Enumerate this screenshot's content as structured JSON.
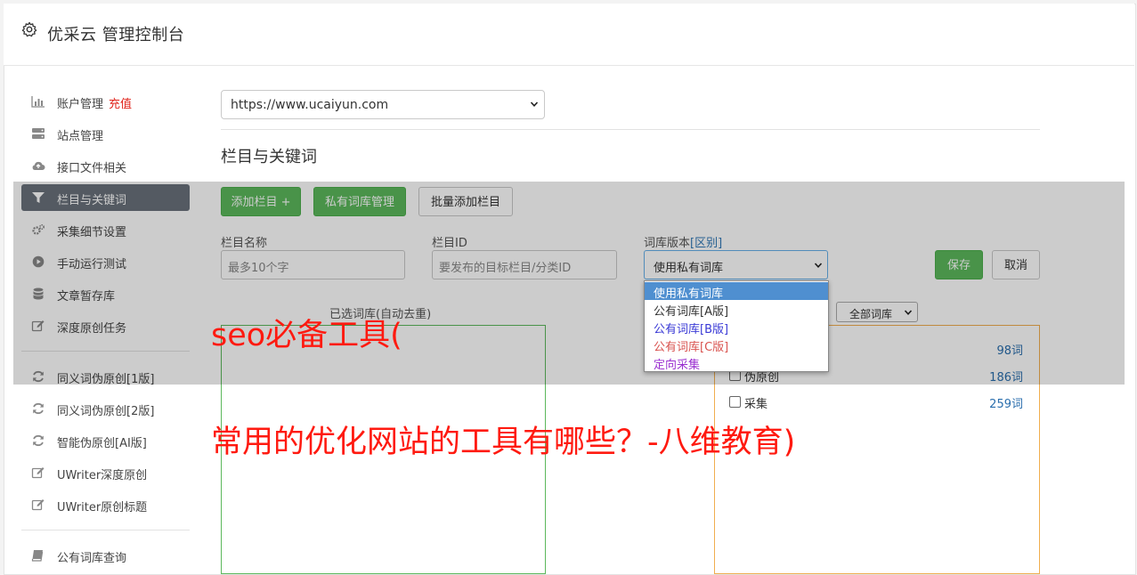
{
  "app": {
    "title": "优采云 管理控制台",
    "icon": "gear-icon"
  },
  "sidebar": {
    "items": [
      {
        "label": "账户管理",
        "badge": "充值",
        "icon": "bar-chart-icon"
      },
      {
        "label": "站点管理",
        "icon": "server-icon"
      },
      {
        "label": "接口文件相关",
        "icon": "cloud-upload-icon"
      },
      {
        "label": "栏目与关键词",
        "icon": "filter-icon",
        "active": true
      },
      {
        "label": "采集细节设置",
        "icon": "cogs-icon"
      },
      {
        "label": "手动运行测试",
        "icon": "play-circle-icon"
      },
      {
        "label": "文章暂存库",
        "icon": "database-icon"
      },
      {
        "label": "深度原创任务",
        "icon": "edit-icon"
      },
      {
        "label": "同义词伪原创[1版]",
        "icon": "refresh-icon"
      },
      {
        "label": "同义词伪原创[2版]",
        "icon": "refresh-icon"
      },
      {
        "label": "智能伪原创[AI版]",
        "icon": "refresh-icon"
      },
      {
        "label": "UWriter深度原创",
        "icon": "edit-icon"
      },
      {
        "label": "UWriter原创标题",
        "icon": "edit-icon"
      },
      {
        "label": "公有词库查询",
        "icon": "book-icon"
      }
    ]
  },
  "site_select": {
    "value": "https://www.ucaiyun.com"
  },
  "section_title": "栏目与关键词",
  "toolbar": {
    "add_column": "添加栏目 +",
    "private_lexicon": "私有词库管理",
    "batch_add": "批量添加栏目"
  },
  "form": {
    "column_name": {
      "label": "栏目名称",
      "placeholder": "最多10个字"
    },
    "column_id": {
      "label": "栏目ID",
      "placeholder": "要发布的目标栏目/分类ID"
    },
    "lexicon_version": {
      "label": "词库版本",
      "link": "[区别]",
      "value": "使用私有词库",
      "options": [
        {
          "label": "使用私有词库",
          "color": "#ffffff",
          "selected": true
        },
        {
          "label": "公有词库[A版]",
          "color": "#333333"
        },
        {
          "label": "公有词库[B版]",
          "color": "#3a3ad6"
        },
        {
          "label": "公有词库[C版]",
          "color": "#d9534f"
        },
        {
          "label": "定向采集",
          "color": "#9b30d0"
        }
      ]
    },
    "save": "保存",
    "cancel": "取消"
  },
  "selected_panel": {
    "legend": "已选词库(自动去重)",
    "color": "#5cb85c"
  },
  "lexicon_panel": {
    "color": "#f0ad4e",
    "filter": "全部词库",
    "rows": [
      {
        "name": "",
        "count": "98词"
      },
      {
        "name": "伪原创",
        "count": "186词"
      },
      {
        "name": "采集",
        "count": "259词"
      }
    ]
  },
  "watermark": {
    "line1": "seo必备工具(",
    "line2": "常用的优化网站的工具有哪些？-八维教育)",
    "color": "#ff1a10"
  }
}
